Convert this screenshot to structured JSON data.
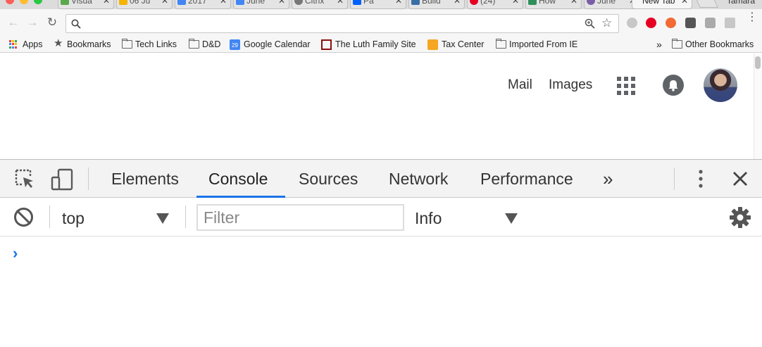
{
  "browser": {
    "tabs": [
      {
        "label": "Visua",
        "favicon_color": "#5aa84a"
      },
      {
        "label": "06 Ju",
        "favicon_color": "#f4b400"
      },
      {
        "label": "2017",
        "favicon_color": "#4285f4"
      },
      {
        "label": "June",
        "favicon_color": "#4285f4"
      },
      {
        "label": "Citrix",
        "favicon_color": "#777777"
      },
      {
        "label": "Pa",
        "favicon_color": "#0061ff"
      },
      {
        "label": "Build",
        "favicon_color": "#3b6ea5"
      },
      {
        "label": "(24)",
        "favicon_color": "#e60023"
      },
      {
        "label": "How",
        "favicon_color": "#2f8f5b"
      },
      {
        "label": "June",
        "favicon_color": "#7b5ea7"
      },
      {
        "label": "New Tab",
        "favicon_color": "#ffffff",
        "active": true
      }
    ],
    "profile_name": "Tamara",
    "toolbar": {
      "back_icon": "arrow-left-icon",
      "forward_icon": "arrow-right-icon",
      "reload_icon": "reload-icon",
      "url": "",
      "extension_colors": [
        "#bbbbbb",
        "#e60023",
        "#f26a35",
        "#555555",
        "#aaaaaa",
        "#bbbbbb",
        "#bbbbbb"
      ]
    },
    "bookmarks": [
      {
        "label": "Apps",
        "icon": "apps-icon"
      },
      {
        "label": "Bookmarks",
        "icon": "star-icon"
      },
      {
        "label": "Tech Links",
        "icon": "folder-icon"
      },
      {
        "label": "D&D",
        "icon": "folder-icon"
      },
      {
        "label": "Google Calendar",
        "icon": "calendar-icon"
      },
      {
        "label": "The Luth Family Site",
        "icon": "site-icon"
      },
      {
        "label": "Tax Center",
        "icon": "tax-icon"
      },
      {
        "label": "Imported From IE",
        "icon": "folder-icon"
      }
    ],
    "bookmarks_overflow": "»",
    "other_bookmarks": "Other Bookmarks"
  },
  "page": {
    "mail_label": "Mail",
    "images_label": "Images"
  },
  "devtools": {
    "tabs": [
      "Elements",
      "Console",
      "Sources",
      "Network",
      "Performance"
    ],
    "active_tab": "Console",
    "more_tabs": "»",
    "context": "top",
    "filter_placeholder": "Filter",
    "level": "Info",
    "prompt": "›",
    "accent_color": "#1a73e8"
  }
}
